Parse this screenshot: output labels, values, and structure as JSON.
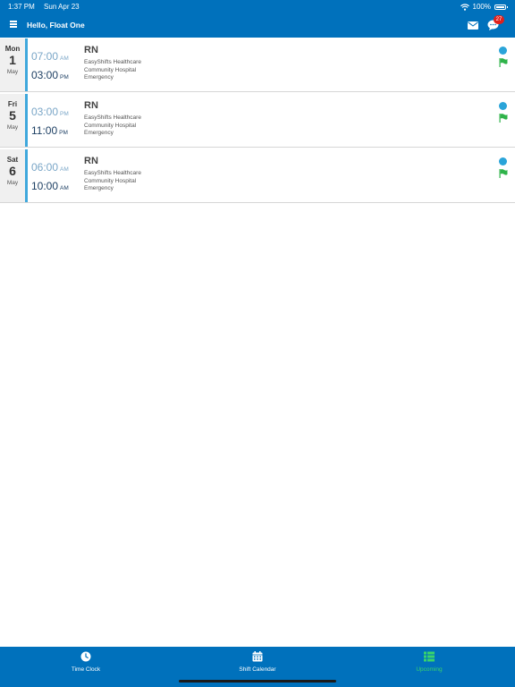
{
  "status": {
    "time": "1:37 PM",
    "date": "Sun Apr 23",
    "battery": "100%"
  },
  "header": {
    "greeting": "Hello, Float One",
    "badge_count": "27"
  },
  "shifts": [
    {
      "dow": "Mon",
      "day": "1",
      "month": "May",
      "start": "07:00",
      "start_ampm": "AM",
      "end": "03:00",
      "end_ampm": "PM",
      "role": "RN",
      "org": "EasyShifts Healthcare",
      "facility": "Community Hospital",
      "department": "Emergency"
    },
    {
      "dow": "Fri",
      "day": "5",
      "month": "May",
      "start": "03:00",
      "start_ampm": "PM",
      "end": "11:00",
      "end_ampm": "PM",
      "role": "RN",
      "org": "EasyShifts Healthcare",
      "facility": "Community Hospital",
      "department": "Emergency"
    },
    {
      "dow": "Sat",
      "day": "6",
      "month": "May",
      "start": "06:00",
      "start_ampm": "AM",
      "end": "10:00",
      "end_ampm": "AM",
      "role": "RN",
      "org": "EasyShifts Healthcare",
      "facility": "Community Hospital",
      "department": "Emergency"
    }
  ],
  "tabs": [
    {
      "label": "Time Clock",
      "icon": "clock-icon"
    },
    {
      "label": "Shift Calendar",
      "icon": "calendar-icon"
    },
    {
      "label": "Upcoming",
      "icon": "list-icon",
      "active": true
    }
  ],
  "colors": {
    "brand": "#0071bc",
    "accent": "#3fa8dc",
    "active_tab": "#39d46b",
    "flag": "#2fb34a",
    "badge": "#e0201c",
    "status_dot": "#2aa4d9"
  }
}
